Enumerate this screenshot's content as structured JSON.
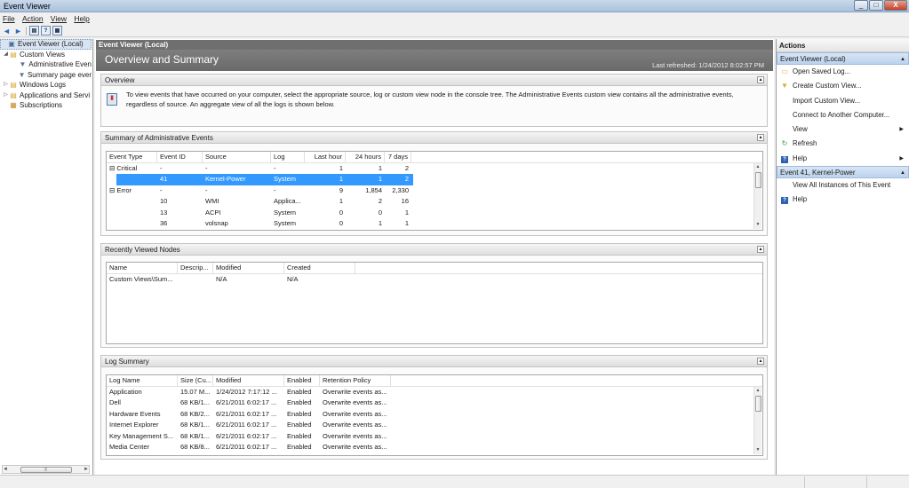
{
  "window": {
    "title": "Event Viewer",
    "controls": [
      "_",
      "□",
      "X"
    ]
  },
  "menu": {
    "file": "File",
    "action": "Action",
    "view": "View",
    "help": "Help"
  },
  "toolbar": {
    "back": "◄",
    "forward": "►",
    "b1": "▤",
    "b2": "?",
    "b3": "▦"
  },
  "tree": {
    "items": [
      {
        "label": "Event Viewer (Local)",
        "icon": "computer-icon"
      },
      {
        "label": "Custom Views",
        "icon": "folder-icon"
      },
      {
        "label": "Administrative Even",
        "icon": "filter-icon"
      },
      {
        "label": "Summary page ever",
        "icon": "filter-icon"
      },
      {
        "label": "Windows Logs",
        "icon": "folder-icon"
      },
      {
        "label": "Applications and Servi",
        "icon": "folder-icon"
      },
      {
        "label": "Subscriptions",
        "icon": "subscriptions-icon"
      }
    ],
    "scroll_mark": "|||"
  },
  "center": {
    "header": "Event Viewer (Local)",
    "title": "Overview and Summary",
    "refreshed": "Last refreshed: 1/24/2012 8:02:57 PM"
  },
  "overview": {
    "title": "Overview",
    "text": "To view events that have occurred on your computer, select the appropriate source, log or custom view node in the console tree. The Administrative Events custom view contains all the administrative events, regardless of source. An aggregate view of all the logs is shown below."
  },
  "summary": {
    "title": "Summary of Administrative Events",
    "headers": [
      "Event Type",
      "Event ID",
      "Source",
      "Log",
      "Last hour",
      "24 hours",
      "7 days"
    ],
    "rows": [
      [
        "⊟ Critical",
        "-",
        "-",
        "-",
        "1",
        "1",
        "2"
      ],
      [
        "",
        "41",
        "Kernel-Power",
        "System",
        "1",
        "1",
        "2"
      ],
      [
        "⊟ Error",
        "-",
        "-",
        "-",
        "9",
        "1,854",
        "2,330"
      ],
      [
        "",
        "10",
        "WMI",
        "Applica...",
        "1",
        "2",
        "16"
      ],
      [
        "",
        "13",
        "ACPI",
        "System",
        "0",
        "0",
        "1"
      ],
      [
        "",
        "36",
        "volsnap",
        "System",
        "0",
        "1",
        "1"
      ]
    ],
    "selected_row": 1
  },
  "recent": {
    "title": "Recently Viewed Nodes",
    "headers": [
      "Name",
      "Descrip...",
      "Modified",
      "Created"
    ],
    "rows": [
      [
        "Custom Views\\Sum...",
        "",
        "N/A",
        "N/A"
      ]
    ]
  },
  "logs": {
    "title": "Log Summary",
    "headers": [
      "Log Name",
      "Size (Cu...",
      "Modified",
      "Enabled",
      "Retention Policy"
    ],
    "rows": [
      [
        "Application",
        "15.07 M...",
        "1/24/2012 7:17:12 ...",
        "Enabled",
        "Overwrite events as..."
      ],
      [
        "Dell",
        "68 KB/1...",
        "6/21/2011 6:02:17 ...",
        "Enabled",
        "Overwrite events as..."
      ],
      [
        "Hardware Events",
        "68 KB/2...",
        "6/21/2011 6:02:17 ...",
        "Enabled",
        "Overwrite events as..."
      ],
      [
        "Internet Explorer",
        "68 KB/1...",
        "6/21/2011 6:02:17 ...",
        "Enabled",
        "Overwrite events as..."
      ],
      [
        "Key Management S...",
        "68 KB/1...",
        "6/21/2011 6:02:17 ...",
        "Enabled",
        "Overwrite events as..."
      ],
      [
        "Media Center",
        "68 KB/8...",
        "6/21/2011 6:02:17 ...",
        "Enabled",
        "Overwrite events as..."
      ]
    ]
  },
  "actions": {
    "title": "Actions",
    "sections": [
      {
        "title": "Event Viewer (Local)",
        "items": [
          {
            "label": "Open Saved Log...",
            "icon": "open-log-icon",
            "sub": false
          },
          {
            "label": "Create Custom View...",
            "icon": "filter-icon",
            "sub": false
          },
          {
            "label": "Import Custom View...",
            "icon": "",
            "sub": false
          },
          {
            "label": "Connect to Another Computer...",
            "icon": "",
            "sub": false
          },
          {
            "label": "View",
            "icon": "",
            "sub": true
          },
          {
            "label": "Refresh",
            "icon": "refresh-icon",
            "sub": false
          },
          {
            "label": "Help",
            "icon": "help-icon",
            "sub": true
          }
        ]
      },
      {
        "title": "Event 41, Kernel-Power",
        "items": [
          {
            "label": "View All Instances of This Event",
            "icon": "",
            "sub": false
          },
          {
            "label": "Help",
            "icon": "help-icon",
            "sub": false
          }
        ]
      }
    ]
  }
}
